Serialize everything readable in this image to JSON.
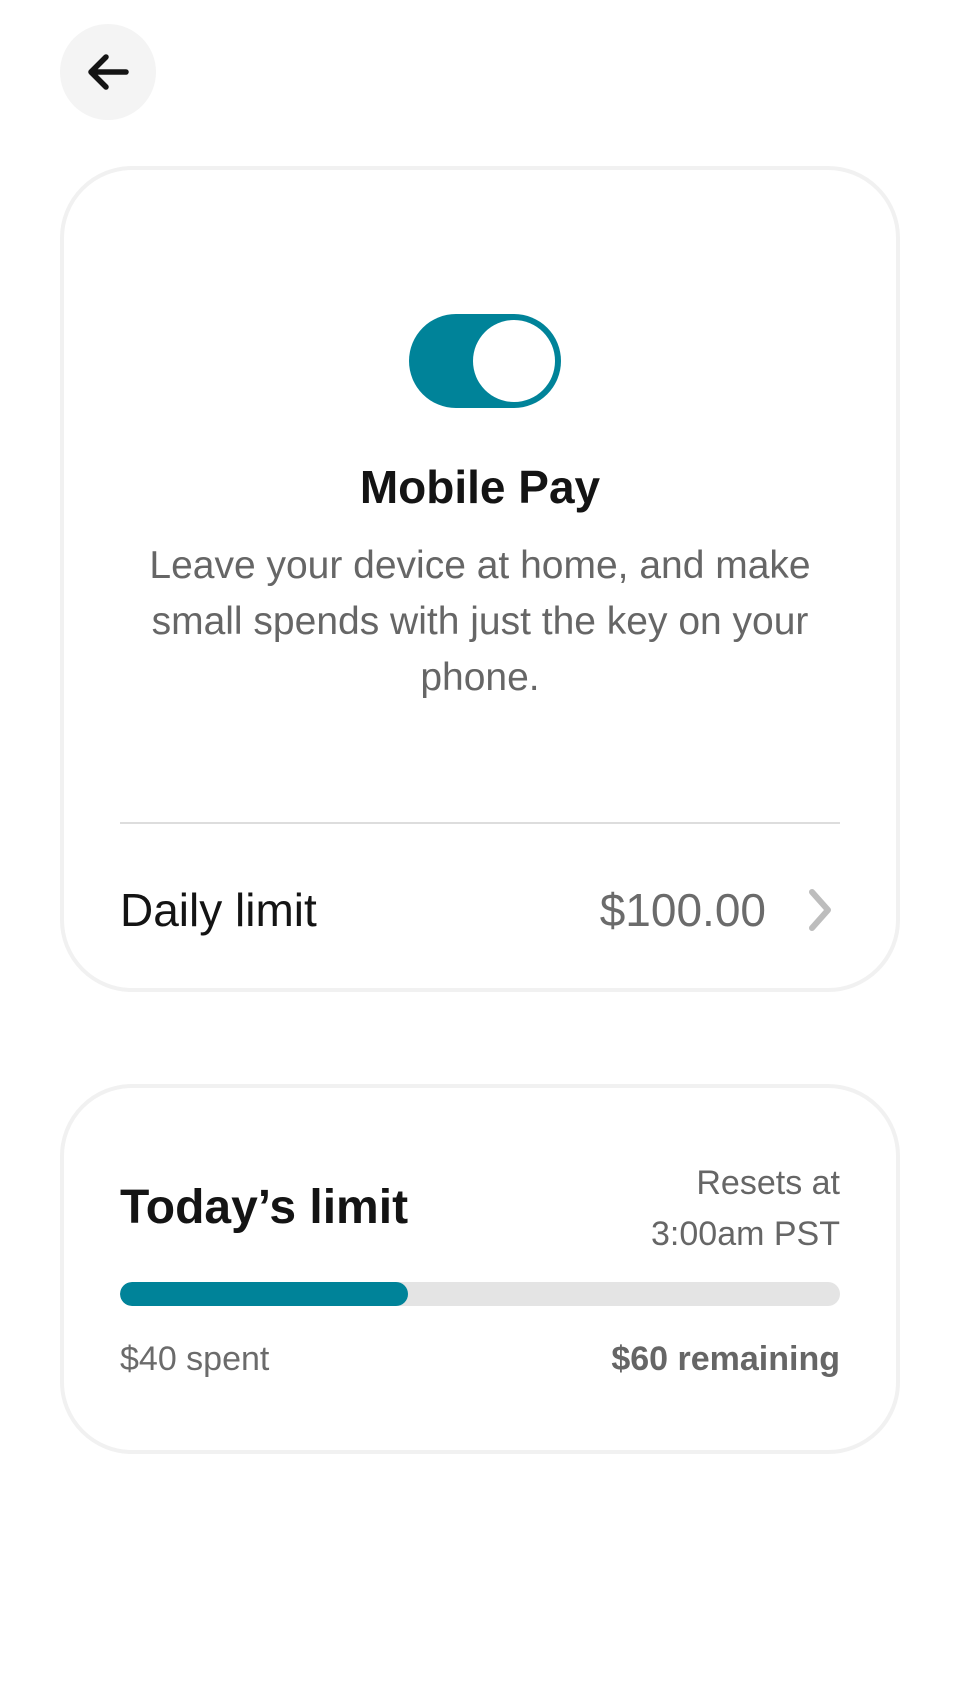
{
  "header": {
    "back_icon": "arrow-left-icon"
  },
  "mobile_pay": {
    "toggle_state": "on",
    "toggle_color": "#008399",
    "title": "Mobile Pay",
    "description": "Leave your device at home, and make small spends with just the key on your phone.",
    "daily_limit_label": "Daily limit",
    "daily_limit_value": "$100.00",
    "chevron_icon": "chevron-right-icon"
  },
  "todays_limit": {
    "title": "Today’s limit",
    "resets_line1": "Resets at",
    "resets_line2": "3:00am PST",
    "progress_fraction": 0.4,
    "spent_text": "$40 spent",
    "remaining_text": "$60 remaining"
  }
}
